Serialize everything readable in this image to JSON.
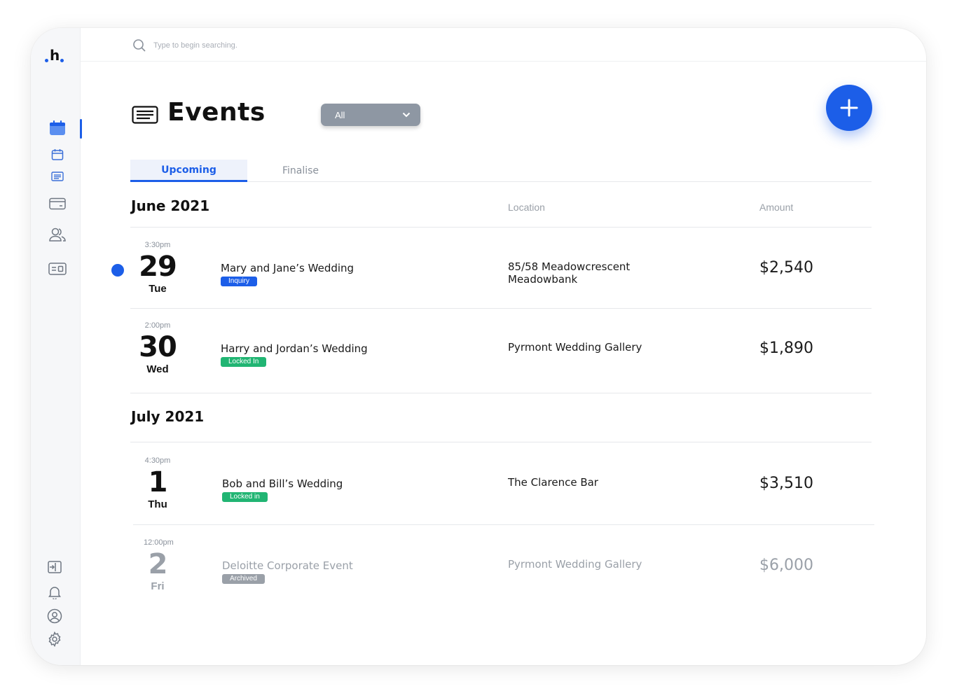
{
  "app": {
    "logo_text": "h",
    "accent": "#1c5ee8"
  },
  "sidebar": {
    "items": [
      {
        "name": "calendar-filled",
        "icon": "calendar-icon",
        "active": true
      },
      {
        "name": "calendar-outline",
        "icon": "calendar-outline-icon"
      },
      {
        "name": "events",
        "icon": "list-card-icon"
      },
      {
        "name": "payments",
        "icon": "credit-card-icon"
      },
      {
        "name": "people",
        "icon": "users-icon"
      },
      {
        "name": "contacts",
        "icon": "id-card-icon"
      }
    ],
    "bottom_items": [
      {
        "name": "logout",
        "icon": "logout-icon"
      },
      {
        "name": "notifications",
        "icon": "bell-icon"
      },
      {
        "name": "profile",
        "icon": "user-circle-icon"
      },
      {
        "name": "settings",
        "icon": "gear-icon"
      }
    ]
  },
  "search": {
    "placeholder": "Type to begin searching."
  },
  "header": {
    "title": "Events",
    "filter_value": "All"
  },
  "tabs": [
    {
      "label": "Upcoming",
      "active": true
    },
    {
      "label": "Finalise",
      "active": false
    }
  ],
  "columns": {
    "location": "Location",
    "amount": "Amount"
  },
  "groups": [
    {
      "month": "June 2021",
      "events": [
        {
          "time": "3:30pm",
          "day": "29",
          "dow": "Tue",
          "name": "Mary and Jane’s Wedding",
          "status": "Inquiry",
          "status_color": "#1c5ee8",
          "location_line1": "85/58 Meadowcrescent",
          "location_line2": "Meadowbank",
          "amount": "$2,540"
        },
        {
          "time": "2:00pm",
          "day": "30",
          "dow": "Wed",
          "name": "Harry and Jordan’s Wedding",
          "status": "Locked In",
          "status_color": "#21b573",
          "location_line1": "Pyrmont Wedding Gallery",
          "location_line2": "",
          "amount": "$1,890"
        }
      ]
    },
    {
      "month": "July 2021",
      "events": [
        {
          "time": "4:30pm",
          "day": "1",
          "dow": "Thu",
          "name": "Bob and Bill’s Wedding",
          "status": "Locked in",
          "status_color": "#21b573",
          "location_line1": "The Clarence Bar",
          "location_line2": "",
          "amount": "$3,510"
        },
        {
          "time": "12:00pm",
          "day": "2",
          "dow": "Fri",
          "name": "Deloitte Corporate Event",
          "status": "Archived",
          "status_color": "#9aa0a8",
          "location_line1": "Pyrmont Wedding Gallery",
          "location_line2": "",
          "amount": "$6,000"
        }
      ]
    }
  ]
}
